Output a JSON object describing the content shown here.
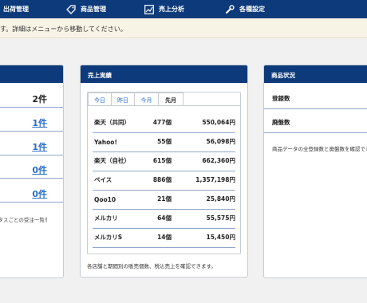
{
  "nav": {
    "items": [
      {
        "label": "出荷管理",
        "icon": "shipping-icon"
      },
      {
        "label": "商品管理",
        "icon": "tag-icon"
      },
      {
        "label": "売上分析",
        "icon": "chart-icon"
      },
      {
        "label": "各種設定",
        "icon": "wrench-icon"
      }
    ]
  },
  "notice": {
    "text": "す。詳細はメニューから移動してください。"
  },
  "left_card": {
    "values": [
      "2件",
      "1件",
      "1件",
      "0件",
      "0件"
    ],
    "note": "ータスごとの受注一覧を"
  },
  "sales_card": {
    "title": "売上実績",
    "tabs": [
      "今日",
      "昨日",
      "今月",
      "先月"
    ],
    "active_tab": "先月",
    "rows": [
      {
        "shop": "楽天（共同）",
        "count": "477個",
        "amount": "550,064円"
      },
      {
        "shop": "Yahoo!",
        "count": "55個",
        "amount": "56,098円"
      },
      {
        "shop": "楽天（自社）",
        "count": "615個",
        "amount": "662,360円"
      },
      {
        "shop": "ベイス",
        "count": "886個",
        "amount": "1,357,198円"
      },
      {
        "shop": "Qoo10",
        "count": "21個",
        "amount": "25,840円"
      },
      {
        "shop": "メルカリ",
        "count": "64個",
        "amount": "55,575円"
      },
      {
        "shop": "メルカリS",
        "count": "14個",
        "amount": "15,450円"
      }
    ],
    "note": "各店舗と期間別の販売個数、税込売上を確認できます。"
  },
  "product_card": {
    "title": "商品状況",
    "registered_label": "登録数",
    "discontinued_label": "廃盤数",
    "note": "商品データの全登録数と廃盤数を確認でき"
  },
  "colors": {
    "nav_bg": "#0d3a7a",
    "link": "#2a6fc9",
    "notice_bg": "#f7f4e6"
  }
}
